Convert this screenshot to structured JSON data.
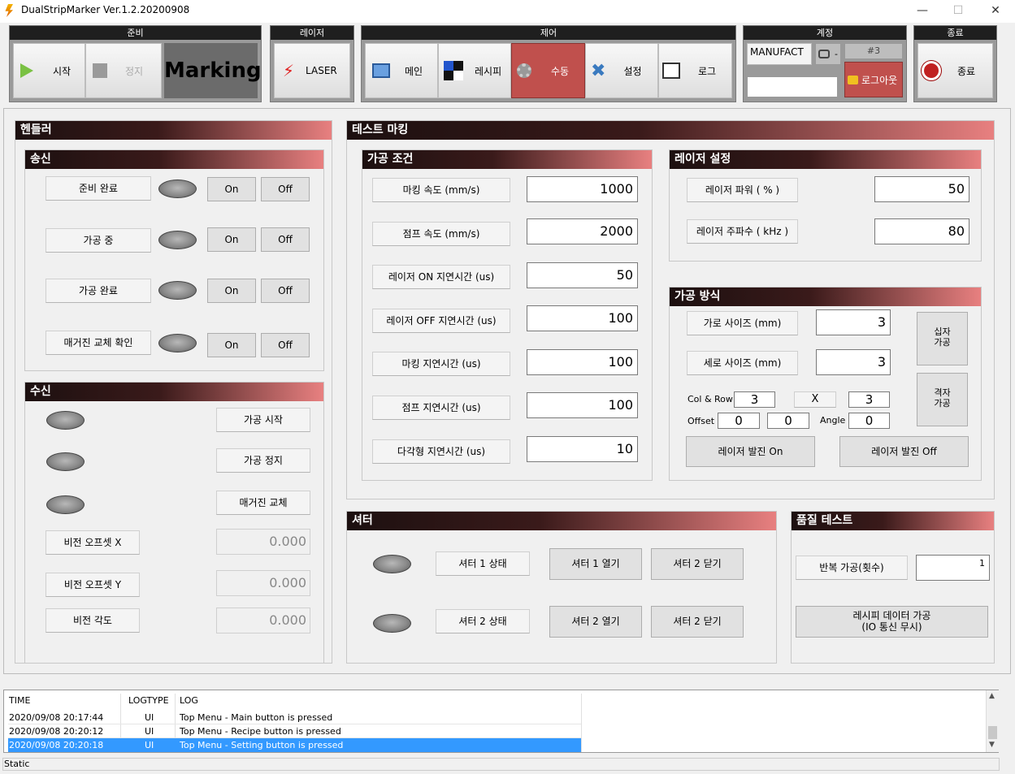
{
  "window": {
    "title": "DualStripMarker Ver.1.2.20200908",
    "minimize": "—",
    "maximize": "☐",
    "close": "✕"
  },
  "toolbar": {
    "ready_group": "준비",
    "start": "시작",
    "stop": "정지",
    "marking": "Marking",
    "laser_group": "레이저",
    "laser": "LASER",
    "control_group": "제어",
    "main": "메인",
    "recipe": "레시피",
    "manual": "수동",
    "settings": "설정",
    "log": "로그",
    "account_group": "계정",
    "user": "MANUFACT",
    "user_level": "-",
    "user_id": "#3",
    "logout": "로그아웃",
    "exit_group": "종료",
    "exit": "종료",
    "active_color": "#c0504d"
  },
  "handler": {
    "title": "헨들러",
    "send": {
      "title": "송신",
      "rows": [
        {
          "label": "준비 완료",
          "on": "On",
          "off": "Off"
        },
        {
          "label": "가공 중",
          "on": "On",
          "off": "Off"
        },
        {
          "label": "가공 완료",
          "on": "On",
          "off": "Off"
        },
        {
          "label": "매거진 교체 확인",
          "on": "On",
          "off": "Off"
        }
      ]
    },
    "receive": {
      "title": "수신",
      "signals": [
        "가공 시작",
        "가공 정지",
        "매거진 교체"
      ],
      "vision": [
        {
          "label": "비전 오프셋 X",
          "value": "0.000"
        },
        {
          "label": "비전 오프셋 Y",
          "value": "0.000"
        },
        {
          "label": "비전 각도",
          "value": "0.000"
        }
      ]
    }
  },
  "test_marking": {
    "title": "테스트 마킹",
    "process": {
      "title": "가공 조건",
      "rows": [
        {
          "label": "마킹 속도 (mm/s)",
          "value": "1000"
        },
        {
          "label": "점프 속도 (mm/s)",
          "value": "2000"
        },
        {
          "label": "레이저 ON 지연시간 (us)",
          "value": "50"
        },
        {
          "label": "레이저 OFF 지연시간 (us)",
          "value": "100"
        },
        {
          "label": "마킹 지연시간 (us)",
          "value": "100"
        },
        {
          "label": "점프 지연시간 (us)",
          "value": "100"
        },
        {
          "label": "다각형 지연시간 (us)",
          "value": "10"
        }
      ]
    },
    "laser": {
      "title": "레이저 설정",
      "power_label": "레이저 파워 ( % )",
      "power": "50",
      "freq_label": "레이저 주파수 ( kHz )",
      "freq": "80"
    },
    "method": {
      "title": "가공 방식",
      "width_label": "가로 사이즈 (mm)",
      "width": "3",
      "height_label": "세로 사이즈 (mm)",
      "height": "3",
      "cross_btn": "십자\n가공",
      "grid_btn": "격자\n가공",
      "colrow_label": "Col & Row",
      "col": "3",
      "x_sep": "X",
      "row": "3",
      "offset_label": "Offset",
      "offset_x": "0",
      "offset_y": "0",
      "angle_label": "Angle",
      "angle": "0",
      "fire_on": "레이저 발진 On",
      "fire_off": "레이저 발진 Off"
    }
  },
  "shutter": {
    "title": "셔터",
    "rows": [
      {
        "state": "셔터 1 상태",
        "open": "셔터 1 열기",
        "close": "셔터 2 닫기"
      },
      {
        "state": "셔터 2 상태",
        "open": "셔터 2 열기",
        "close": "셔터 2 닫기"
      }
    ]
  },
  "quality": {
    "title": "품질 테스트",
    "repeat_label": "반복 가공(횟수)",
    "repeat": "1",
    "recipe_btn_1": "레시피 데이터 가공",
    "recipe_btn_2": "(IO 통신 무시)"
  },
  "log": {
    "headers": [
      "TIME",
      "LOGTYPE",
      "LOG"
    ],
    "rows": [
      {
        "time": "2020/09/08 20:17:44",
        "type": "UI",
        "msg": "Top Menu - Main button is pressed"
      },
      {
        "time": "2020/09/08 20:20:12",
        "type": "UI",
        "msg": "Top Menu - Recipe button is pressed"
      },
      {
        "time": "2020/09/08 20:20:18",
        "type": "UI",
        "msg": "Top Menu - Setting button is pressed"
      }
    ],
    "selected_color": "#3399ff"
  },
  "status": "Static"
}
